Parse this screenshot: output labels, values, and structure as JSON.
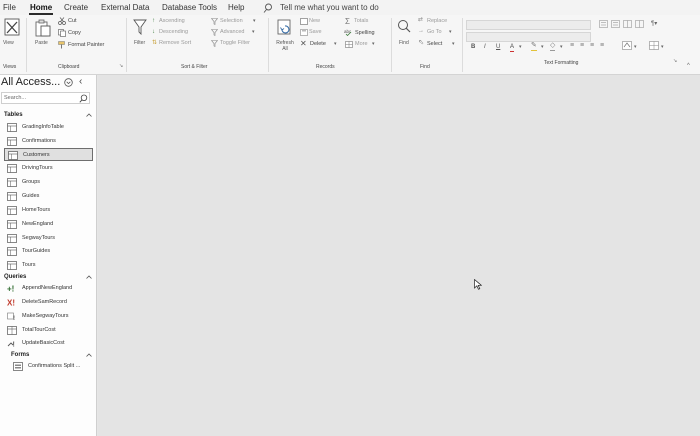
{
  "menu": {
    "items": [
      "File",
      "Home",
      "Create",
      "External Data",
      "Database Tools",
      "Help"
    ],
    "tell_me": "Tell me what you want to do"
  },
  "ribbon": {
    "views": {
      "view_label": "View",
      "group_label": "Views"
    },
    "clipboard": {
      "paste_label": "Paste",
      "cut_label": "Cut",
      "copy_label": "Copy",
      "format_painter_label": "Format Painter",
      "group_label": "Clipboard"
    },
    "sort_filter": {
      "filter_label": "Filter",
      "ascending_label": "Ascending",
      "descending_label": "Descending",
      "remove_sort_label": "Remove Sort",
      "selection_label": "Selection",
      "advanced_label": "Advanced",
      "toggle_filter_label": "Toggle Filter",
      "group_label": "Sort & Filter"
    },
    "records": {
      "refresh_all_label": "Refresh All",
      "new_label": "New",
      "save_label": "Save",
      "delete_label": "Delete",
      "totals_label": "Totals",
      "spelling_label": "Spelling",
      "more_label": "More",
      "group_label": "Records"
    },
    "find": {
      "find_label": "Find",
      "replace_label": "Replace",
      "goto_label": "Go To",
      "select_label": "Select",
      "group_label": "Find"
    },
    "text_formatting": {
      "bold": "B",
      "italic": "I",
      "underline": "U",
      "font_color_letter": "A",
      "group_label": "Text Formatting"
    }
  },
  "nav": {
    "title": "All Access...",
    "search_placeholder": "Search...",
    "sections": [
      {
        "name": "Tables",
        "items": [
          "GradingInfoTable",
          "Confirmations",
          "Customers",
          "DrivingTours",
          "Groups",
          "Guides",
          "HomeTours",
          "NewEngland",
          "SegwayTours",
          "TourGuides",
          "Tours"
        ]
      },
      {
        "name": "Queries",
        "items": [
          "AppendNewEngland",
          "DeleteSamRecord",
          "MakeSegwayTours",
          "TotalTourCost",
          "UpdateBasicCost"
        ]
      },
      {
        "name": "Forms",
        "items": [
          "Confirmations Split ..."
        ]
      }
    ],
    "selected_item": "Customers"
  },
  "colors": {
    "selection_border": "#6e6e6e",
    "workarea": "#e4e4e4",
    "delete_x": "#c0392b"
  }
}
